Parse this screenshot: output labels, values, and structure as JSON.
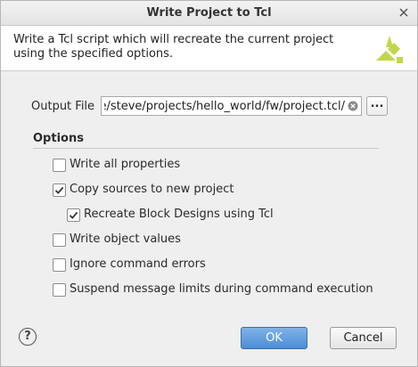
{
  "window": {
    "title": "Write Project to Tcl"
  },
  "banner": {
    "description": "Write a Tcl script which will recreate the current project using the specified options."
  },
  "output_file": {
    "label": "Output File",
    "value": "/home/steve/projects/hello_world/fw/project.tcl",
    "browse_label": "..."
  },
  "options": {
    "heading": "Options",
    "items": [
      {
        "label": "Write all properties",
        "checked": false
      },
      {
        "label": "Copy sources to new project",
        "checked": true
      },
      {
        "label": "Recreate Block Designs using Tcl",
        "checked": true
      },
      {
        "label": "Write object values",
        "checked": false
      },
      {
        "label": "Ignore command errors",
        "checked": false
      },
      {
        "label": "Suspend message limits during command execution",
        "checked": false
      }
    ]
  },
  "buttons": {
    "help": "?",
    "ok": "OK",
    "cancel": "Cancel"
  },
  "colors": {
    "accent": "#5a9be0",
    "logo": "#c3d64a"
  }
}
